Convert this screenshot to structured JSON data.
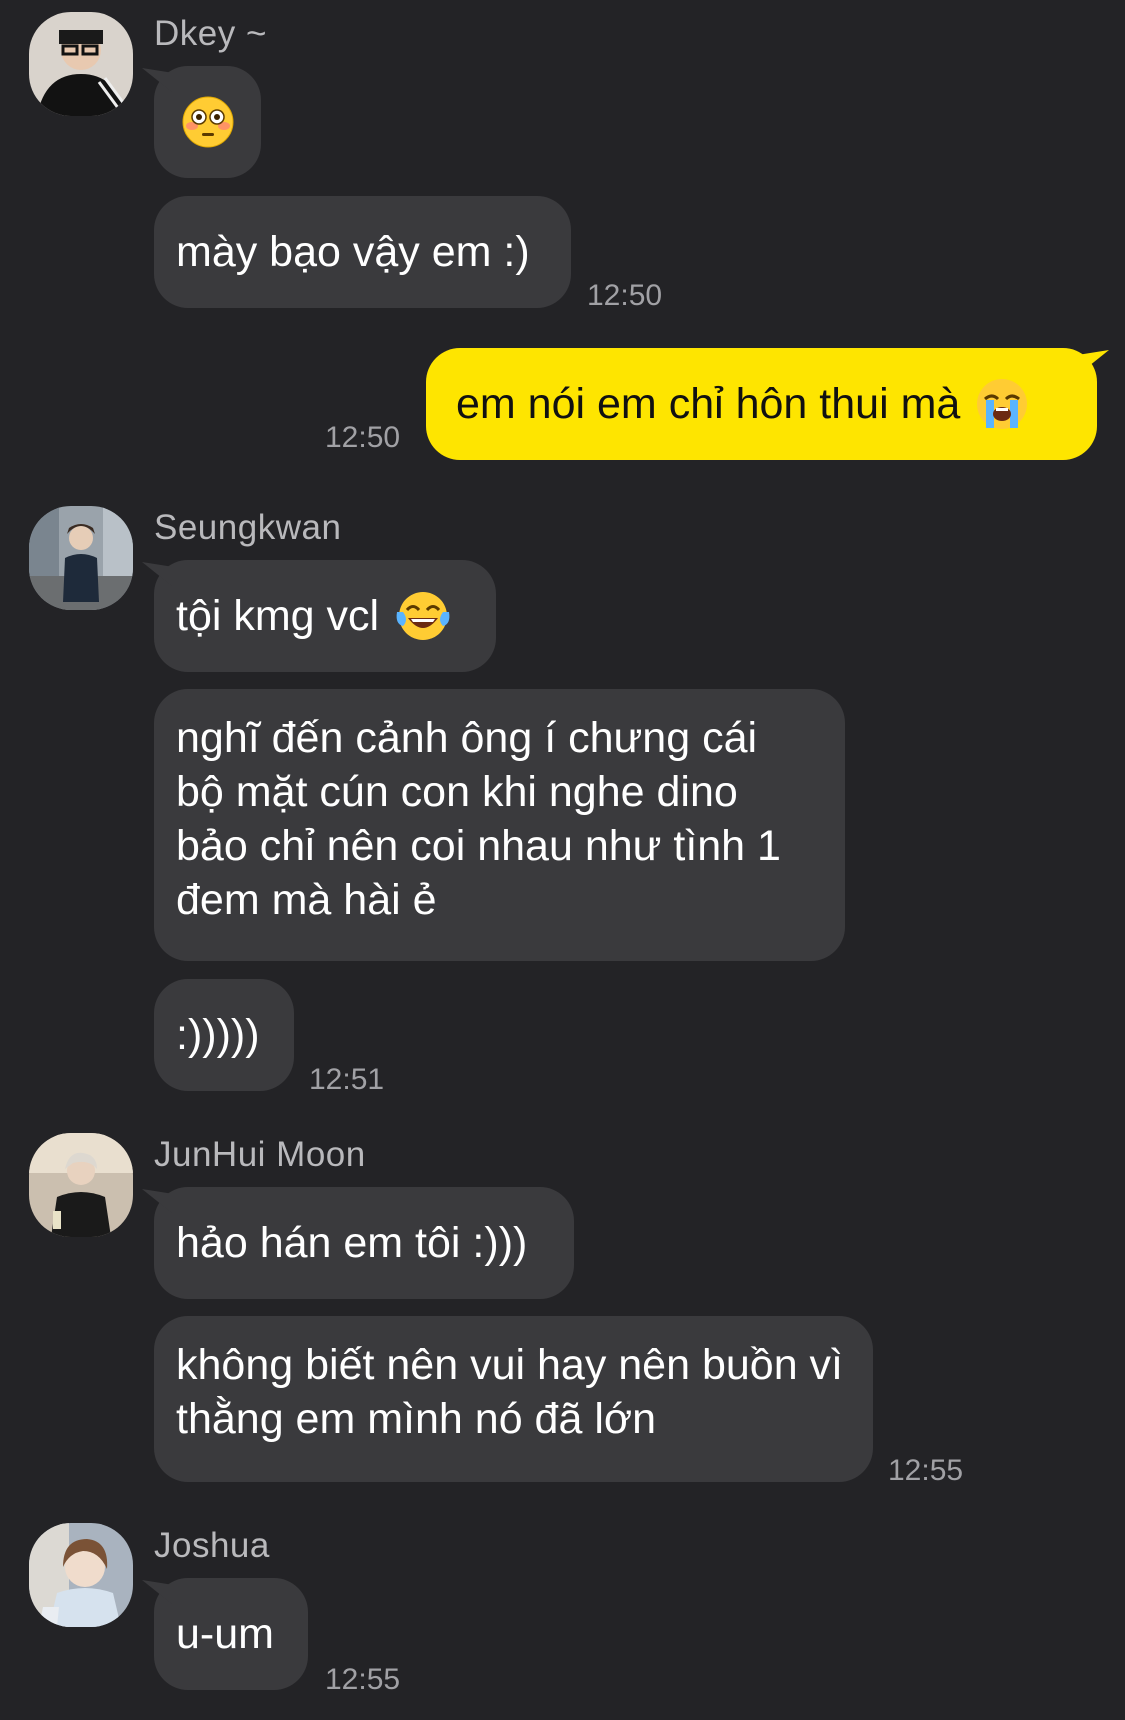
{
  "colors": {
    "background": "#232326",
    "bubble_other": "#3a3a3d",
    "bubble_self": "#fee500",
    "sender_name": "#b9b9bc",
    "timestamp": "#a1a1a5"
  },
  "groups": [
    {
      "sender": "Dkey ~",
      "avatar_icon": "profile-avatar",
      "messages": [
        {
          "text": "",
          "emoji": "flushed-face-emoji"
        },
        {
          "text": "mày bạo vậy em :)"
        }
      ],
      "time": "12:50"
    },
    {
      "sender": "",
      "self": true,
      "messages": [
        {
          "text": "em nói em chỉ hôn thui mà",
          "emoji": "loudly-crying-face-emoji"
        }
      ],
      "time": "12:50"
    },
    {
      "sender": "Seungkwan",
      "avatar_icon": "profile-avatar",
      "messages": [
        {
          "text": "tội kmg vcl",
          "emoji": "tears-of-joy-emoji"
        },
        {
          "text": "nghĩ đến cảnh ông í chưng cái bộ mặt cún con khi nghe dino bảo chỉ nên coi nhau như tình 1 đem mà hài ẻ"
        },
        {
          "text": ":)))))"
        }
      ],
      "time": "12:51"
    },
    {
      "sender": "JunHui Moon",
      "avatar_icon": "profile-avatar",
      "messages": [
        {
          "text": "hảo hán em tôi :)))"
        },
        {
          "text": "không biết nên vui hay nên buồn vì thằng em mình nó đã lớn"
        }
      ],
      "time": "12:55"
    },
    {
      "sender": "Joshua",
      "avatar_icon": "profile-avatar",
      "messages": [
        {
          "text": "u-um"
        }
      ],
      "time": "12:55"
    }
  ]
}
